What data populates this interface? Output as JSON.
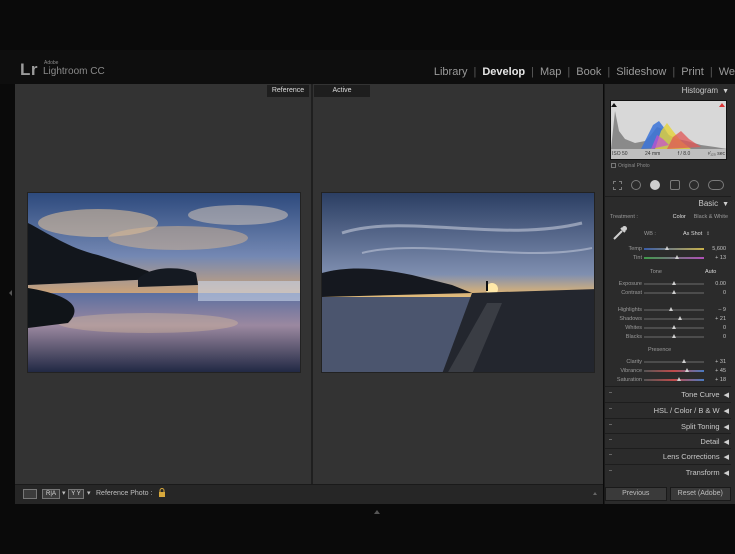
{
  "app": {
    "logo": "Lr",
    "vendor": "Adobe",
    "name": "Lightroom CC"
  },
  "modules": [
    {
      "label": "Library",
      "active": false
    },
    {
      "label": "Develop",
      "active": true
    },
    {
      "label": "Map",
      "active": false
    },
    {
      "label": "Book",
      "active": false
    },
    {
      "label": "Slideshow",
      "active": false
    },
    {
      "label": "Print",
      "active": false
    },
    {
      "label": "We",
      "active": false
    }
  ],
  "view": {
    "reference_tab": "Reference",
    "active_tab": "Active"
  },
  "toolbar": {
    "reference_photo_label": "Reference Photo :",
    "view_mode_1": "R|A",
    "view_mode_2": "Y Y"
  },
  "histogram": {
    "title": "Histogram",
    "iso": "ISO 50",
    "focal": "24 mm",
    "aperture": "f / 8.0",
    "shutter": "¹⁄₁₂₅ sec",
    "original_photo": "Original Photo"
  },
  "basic": {
    "title": "Basic",
    "treatment_label": "Treatment :",
    "treatment_color": "Color",
    "treatment_bw": "Black & White",
    "wb_label": "WB :",
    "wb_value": "As Shot",
    "tone_label": "Tone",
    "auto_label": "Auto",
    "presence_label": "Presence",
    "sliders": [
      {
        "label": "Temp",
        "value": "5,600",
        "pos": 0.38,
        "group": "wb"
      },
      {
        "label": "Tint",
        "value": "+ 13",
        "pos": 0.55,
        "group": "wb"
      },
      {
        "label": "Exposure",
        "value": "0.00",
        "pos": 0.5,
        "group": "tone"
      },
      {
        "label": "Contrast",
        "value": "0",
        "pos": 0.5,
        "group": "tone"
      },
      {
        "label": "Highlights",
        "value": "– 9",
        "pos": 0.45,
        "group": "tone2"
      },
      {
        "label": "Shadows",
        "value": "+ 21",
        "pos": 0.6,
        "group": "tone2"
      },
      {
        "label": "Whites",
        "value": "0",
        "pos": 0.5,
        "group": "tone2"
      },
      {
        "label": "Blacks",
        "value": "0",
        "pos": 0.5,
        "group": "tone2"
      },
      {
        "label": "Clarity",
        "value": "+ 31",
        "pos": 0.66,
        "group": "presence"
      },
      {
        "label": "Vibrance",
        "value": "+ 45",
        "pos": 0.72,
        "group": "presence"
      },
      {
        "label": "Saturation",
        "value": "+ 18",
        "pos": 0.59,
        "group": "presence"
      }
    ]
  },
  "collapsed_panels": [
    "Tone Curve",
    "HSL / Color / B & W",
    "Split Toning",
    "Detail",
    "Lens Corrections",
    "Transform"
  ],
  "buttons": {
    "previous": "Previous",
    "reset": "Reset (Adobe)"
  },
  "colors": {
    "panel_bg": "#2b2b2b",
    "view_bg": "#333333",
    "accent_text": "#e6e6e6"
  }
}
